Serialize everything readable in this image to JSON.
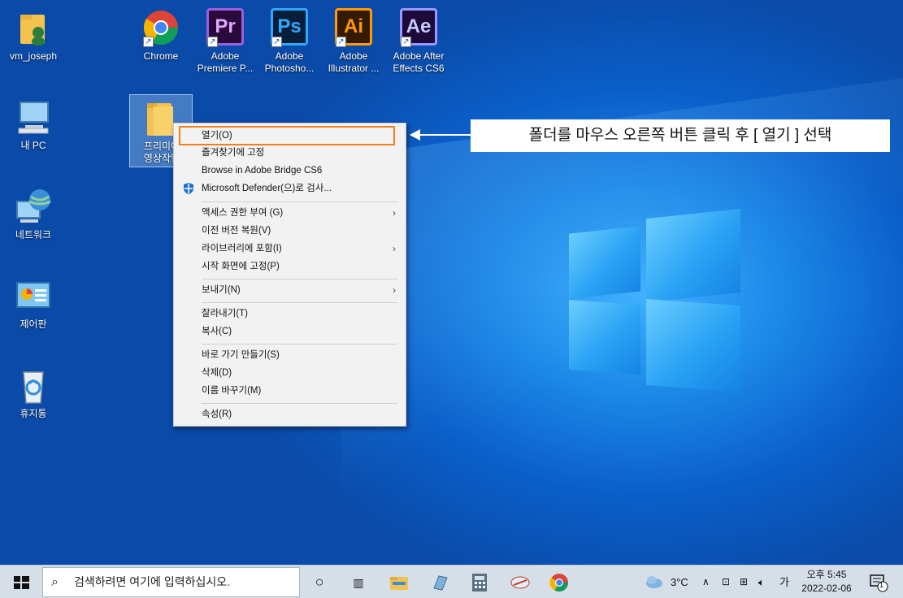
{
  "desktop_icons": [
    {
      "label": "vm_joseph",
      "icon": "user-folder-icon"
    },
    {
      "label": "Chrome",
      "icon": "chrome-icon"
    },
    {
      "label": "Adobe Premiere P...",
      "icon": "premiere-icon",
      "abbr": "Pr"
    },
    {
      "label": "Adobe Photosho...",
      "icon": "photoshop-icon",
      "abbr": "Ps"
    },
    {
      "label": "Adobe Illustrator ...",
      "icon": "illustrator-icon",
      "abbr": "Ai"
    },
    {
      "label": "Adobe After Effects CS6",
      "icon": "after-effects-icon",
      "abbr": "Ae"
    },
    {
      "label": "내 PC",
      "icon": "computer-icon"
    },
    {
      "label": "네트워크",
      "icon": "network-icon"
    },
    {
      "label": "제어판",
      "icon": "control-panel-icon"
    },
    {
      "label": "휴지통",
      "icon": "recycle-bin-icon"
    },
    {
      "label": "프리미어\n영상작업",
      "icon": "folder-icon"
    }
  ],
  "context_menu": {
    "items": [
      {
        "label": "열기(O)"
      },
      {
        "label": "즐겨찾기에 고정"
      },
      {
        "label": "Browse in Adobe Bridge CS6"
      },
      {
        "label": "Microsoft Defender(으)로 검사..."
      },
      {
        "label": "액세스 권한 부여 (G)"
      },
      {
        "label": "이전 버전 복원(V)"
      },
      {
        "label": "라이브러리에 포함(I)"
      },
      {
        "label": "시작 화면에 고정(P)"
      },
      {
        "label": "보내기(N)"
      },
      {
        "label": "잘라내기(T)"
      },
      {
        "label": "복사(C)"
      },
      {
        "label": "바로 가기 만들기(S)"
      },
      {
        "label": "삭제(D)"
      },
      {
        "label": "이름 바꾸기(M)"
      },
      {
        "label": "속성(R)"
      }
    ],
    "submenu_arrow": "›"
  },
  "callout": {
    "text": "폴더를 마우스 오른쪽 버튼 클릭 후 [ 열기 ] 선택"
  },
  "taskbar": {
    "search_placeholder": "검색하려면 여기에 입력하십시오.",
    "weather": "3°C",
    "ime": "가",
    "time": "오후 5:45",
    "date": "2022-02-06",
    "notification_count": "1"
  },
  "colors": {
    "accent": "#f07f1e",
    "taskbar": "#d6dee7",
    "menu": "#f2f2f2"
  }
}
